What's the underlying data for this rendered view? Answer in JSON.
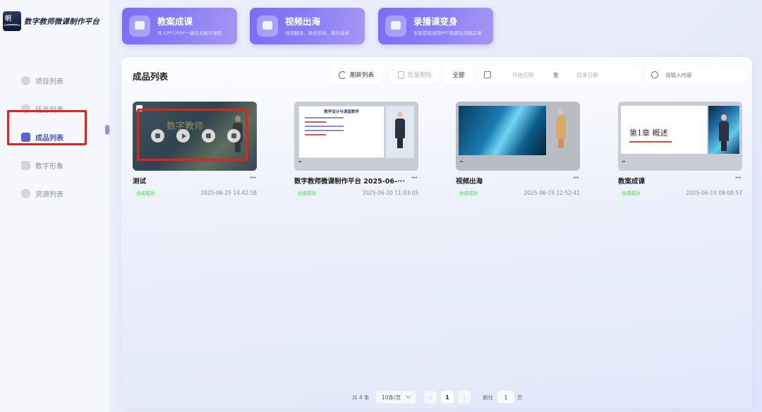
{
  "app": {
    "title": "数字教师微课制作平台",
    "logo_glyph": "明"
  },
  "sidebar": {
    "items": [
      {
        "label": "项目列表",
        "icon": "folder-icon"
      },
      {
        "label": "任务列表",
        "icon": "task-icon"
      },
      {
        "label": "成品列表",
        "icon": "product-icon",
        "active": true
      },
      {
        "label": "数字形象",
        "icon": "avatar-icon"
      },
      {
        "label": "资源列表",
        "icon": "resource-icon"
      }
    ]
  },
  "features": [
    {
      "title": "教案成课",
      "subtitle": "导入PPT/PDF一键生成教学课程"
    },
    {
      "title": "视频出海",
      "subtitle": "视频翻译、换老师讲、换声音讲"
    },
    {
      "title": "录播课变身",
      "subtitle": "智能提取视频PPT画面生成精品课"
    }
  ],
  "panel": {
    "title": "成品列表",
    "refresh_label": "刷新列表",
    "batch_delete_label": "批量删除",
    "filter_all_label": "全部",
    "start_date_placeholder": "开始日期",
    "to_label": "至",
    "end_date_placeholder": "结束日期",
    "search_placeholder": "请输入内容"
  },
  "products": [
    {
      "title": "测试",
      "status": "合成成功",
      "time": "2025-06-25 14:42:58",
      "thumb_text": "数字教师"
    },
    {
      "title": "数字教师微课制作平台 2025-06-···",
      "status": "合成成功",
      "time": "2025-06-20 11:03:05",
      "thumb_text": "教学设计与课堂教学"
    },
    {
      "title": "视频出海",
      "status": "合成成功",
      "time": "2025-06-19 12:52:41",
      "thumb_text": ""
    },
    {
      "title": "教案成课",
      "status": "合成成功",
      "time": "2025-06-19 09:08:57",
      "thumb_text": "第1章 概述"
    }
  ],
  "more_label": "···",
  "pagination": {
    "total_label": "共 4 条",
    "page_size_label": "10条/页",
    "prev": "‹",
    "current_page": "1",
    "next": "›",
    "goto_label": "前往",
    "goto_value": "1",
    "page_unit": "页"
  },
  "colors": {
    "accent": "#5b63d8",
    "feature_gradient_start": "#7b6cf6",
    "highlight_box": "#e0231c",
    "success": "#5bbf7a"
  }
}
